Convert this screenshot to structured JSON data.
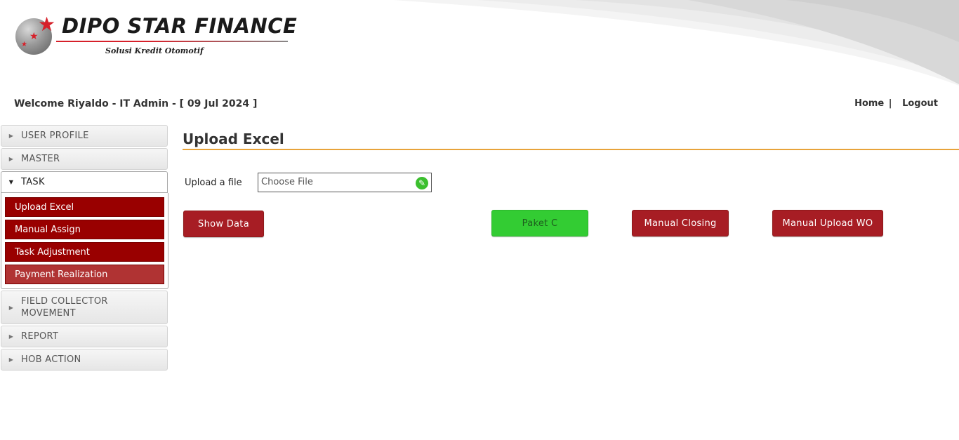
{
  "brand": {
    "name": "DIPO STAR FINANCE",
    "tagline": "Solusi Kredit Otomotif"
  },
  "welcome_text": "Welcome Riyaldo - IT Admin - [ 09 Jul 2024 ]",
  "topnav": {
    "home": "Home",
    "separator": "|",
    "logout": "Logout"
  },
  "sidebar": {
    "sections": [
      {
        "label": "USER PROFILE",
        "expanded": false
      },
      {
        "label": "MASTER",
        "expanded": false
      },
      {
        "label": "TASK",
        "expanded": true
      },
      {
        "label": "FIELD COLLECTOR",
        "label_line2": "MOVEMENT",
        "expanded": false
      },
      {
        "label": "REPORT",
        "expanded": false
      },
      {
        "label": "HOB ACTION",
        "expanded": false
      }
    ],
    "task_items": [
      {
        "label": "Upload Excel"
      },
      {
        "label": "Manual Assign"
      },
      {
        "label": "Task Adjustment"
      },
      {
        "label": "Payment Realization",
        "hovered": true
      }
    ]
  },
  "main": {
    "title": "Upload Excel",
    "upload_label": "Upload a file",
    "file_placeholder": "Choose File",
    "buttons": {
      "show_data": "Show Data",
      "paket_c": "Paket C",
      "manual_closing": "Manual Closing",
      "manual_upload_wo": "Manual Upload WO"
    }
  },
  "colors": {
    "menu_red": "#990000",
    "button_red": "#a71d24",
    "button_green": "#33cc33",
    "title_underline": "#e8a33a",
    "logo_star": "#d6202a"
  },
  "icons": {
    "collapsed": "triangle-right-icon",
    "expanded": "triangle-down-icon",
    "file_attach": "paperclip-icon"
  }
}
